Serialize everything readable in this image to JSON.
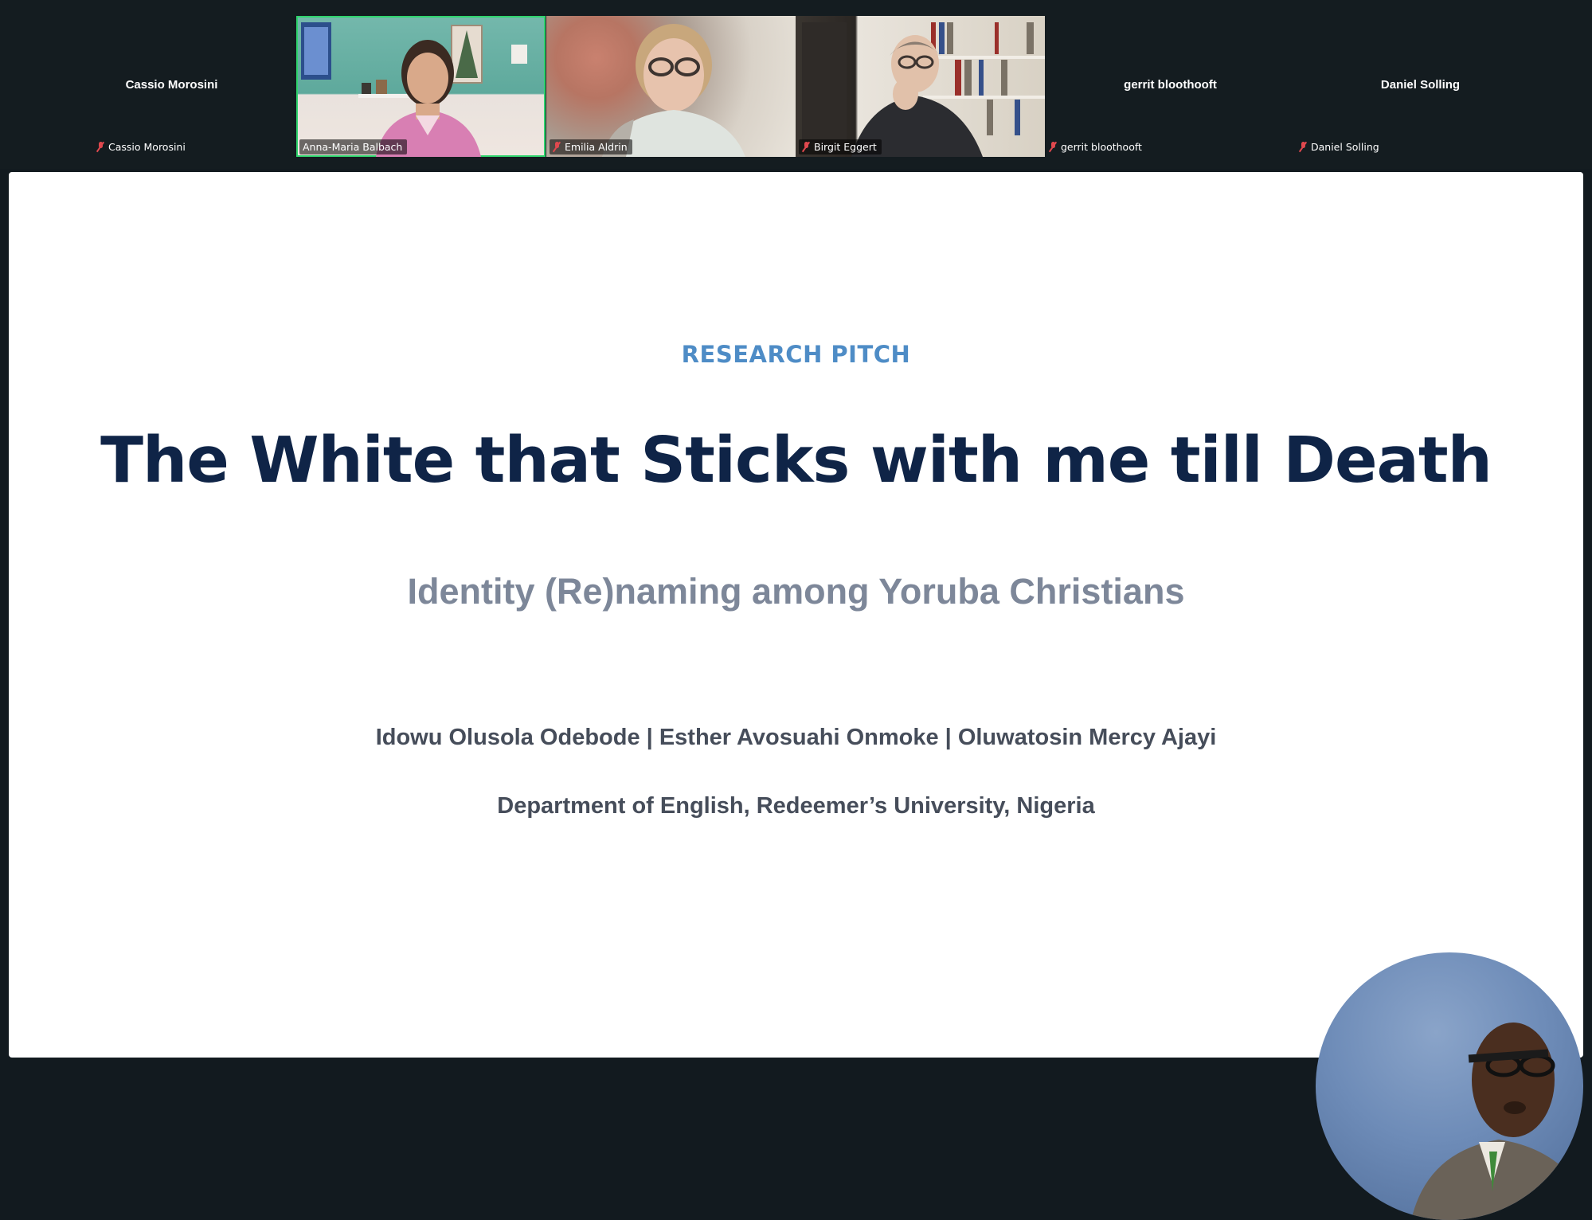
{
  "participants": [
    {
      "name": "Cassio Morosini",
      "video": false,
      "muted": true
    },
    {
      "name": "Anna-Maria Balbach",
      "video": true,
      "muted": false,
      "active_speaker": true
    },
    {
      "name": "Emilia Aldrin",
      "video": true,
      "muted": true
    },
    {
      "name": "Birgit Eggert",
      "video": true,
      "muted": true
    },
    {
      "name": "gerrit bloothooft",
      "video": false,
      "muted": true
    },
    {
      "name": "Daniel Solling",
      "video": false,
      "muted": true
    }
  ],
  "slide": {
    "kicker": "RESEARCH PITCH",
    "title": "The White that Sticks with me till Death",
    "subtitle": "Identity (Re)naming among Yoruba Christians",
    "authors": "Idowu Olusola Odebode | Esther Avosuahi Onmoke | Oluwatosin Mercy Ajayi",
    "affiliation": "Department of English, Redeemer’s University, Nigeria"
  },
  "colors": {
    "strip_background": "#141c20",
    "active_speaker_border": "#2fd36d",
    "muted_icon": "#e0484e",
    "kicker": "#4e8cc6",
    "title": "#0f2447",
    "subtitle": "#7d8799",
    "body_text": "#464d5a"
  }
}
